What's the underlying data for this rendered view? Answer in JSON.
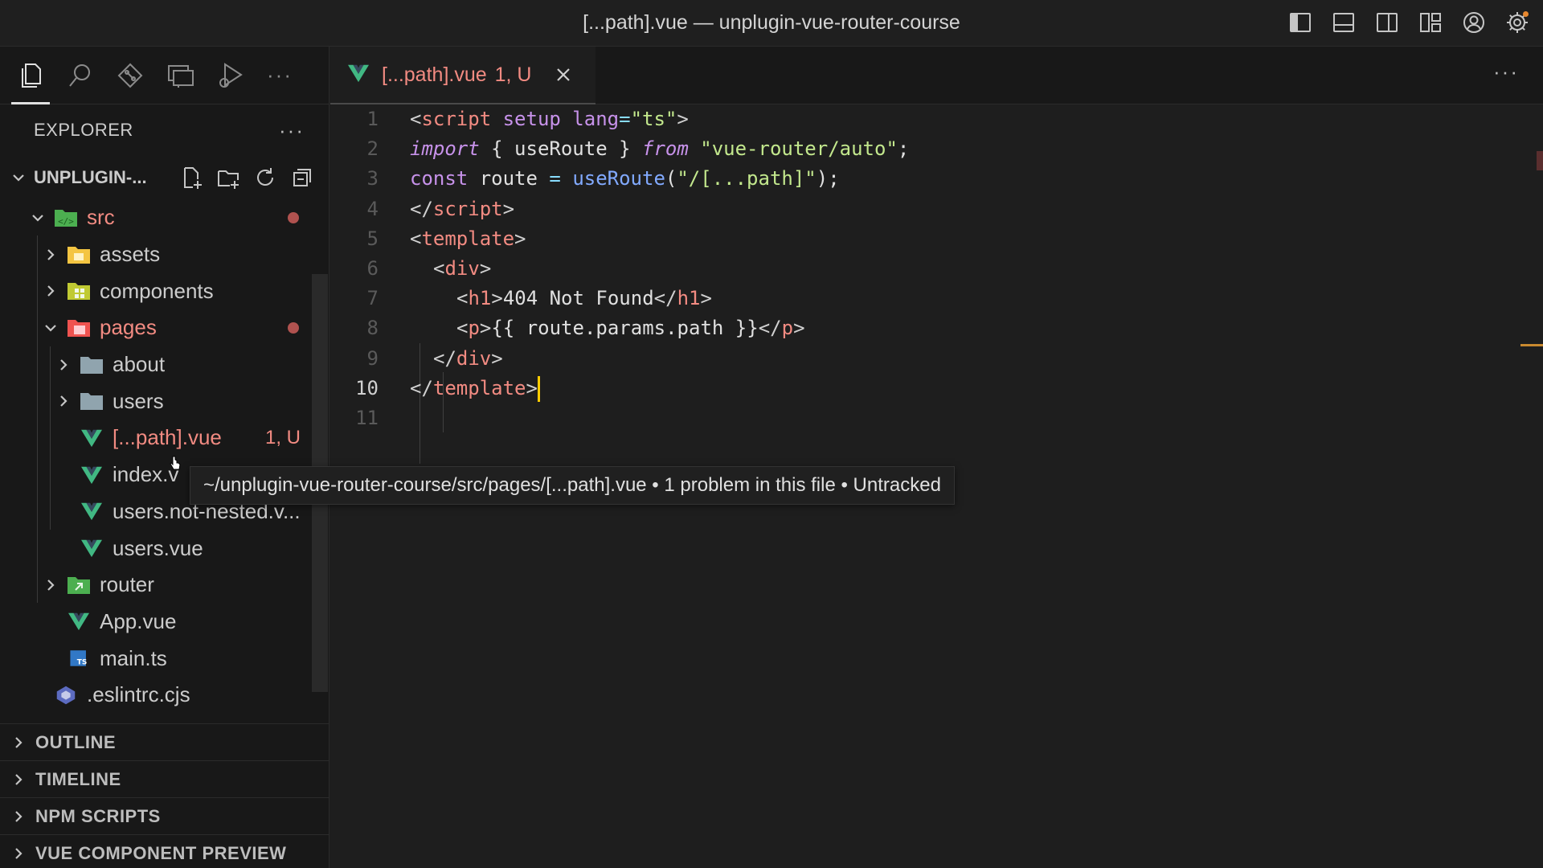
{
  "window": {
    "title": "[...path].vue — unplugin-vue-router-course"
  },
  "titlebar_icons": [
    "toggle-primary-sidebar-icon",
    "toggle-panel-icon",
    "toggle-secondary-sidebar-icon",
    "customize-layout-icon",
    "accounts-icon",
    "manage-gear-icon"
  ],
  "activity": {
    "more": "···"
  },
  "explorer": {
    "title": "EXPLORER",
    "more": "···",
    "project": "UNPLUGIN-..."
  },
  "tree": {
    "src": "src",
    "assets": "assets",
    "components": "components",
    "pages": "pages",
    "about": "about",
    "users": "users",
    "path_vue": "[...path].vue",
    "path_vue_badge": "1, U",
    "index_vue": "index.v",
    "users_not_nested": "users.not-nested.v...",
    "users_vue": "users.vue",
    "router": "router",
    "app_vue": "App.vue",
    "main_ts": "main.ts",
    "eslintrc": ".eslintrc.cjs"
  },
  "panels": {
    "outline": "OUTLINE",
    "timeline": "TIMELINE",
    "npm_scripts": "NPM SCRIPTS",
    "vue_preview": "VUE COMPONENT PREVIEW"
  },
  "tab": {
    "name": "[...path].vue",
    "badge": "1, U",
    "more": "···"
  },
  "code": {
    "line_numbers": [
      "1",
      "2",
      "3",
      "4",
      "5",
      "6",
      "7",
      "8",
      "9",
      "10",
      "11"
    ],
    "l1": {
      "lt": "<",
      "tag": "script",
      "attr1": " setup",
      "attr2": " lang",
      "eq": "=",
      "val": "\"ts\"",
      "gt": ">"
    },
    "l2": {
      "import": "import",
      "p1": " { useRoute } ",
      "from": "from",
      "sp": " ",
      "str": "\"vue-router/auto\"",
      "semi": ";"
    },
    "l3": {
      "const": "const",
      "name": " route ",
      "eq": "=",
      "sp": " ",
      "fn": "useRoute",
      "p1": "(",
      "str": "\"/[...path]\"",
      "p2": ");"
    },
    "l4": {
      "lt": "</",
      "tag": "script",
      "gt": ">"
    },
    "l5": {
      "lt": "<",
      "tag": "template",
      "gt": ">"
    },
    "l6": {
      "lt": "<",
      "tag": "div",
      "gt": ">"
    },
    "l7": {
      "lt": "<",
      "tag": "h1",
      "gt": ">",
      "text": "404 Not Found",
      "lt2": "</",
      "tag2": "h1",
      "gt2": ">"
    },
    "l8": {
      "lt": "<",
      "tag": "p",
      "gt": ">",
      "text": "{{ route.params.path }}",
      "lt2": "</",
      "tag2": "p",
      "gt2": ">"
    },
    "l9": {
      "lt": "</",
      "tag": "div",
      "gt": ">"
    },
    "l10": {
      "lt": "</",
      "tag": "template",
      "gt": ">"
    }
  },
  "tooltip": {
    "text": "~/unplugin-vue-router-course/src/pages/[...path].vue • 1 problem in this file • Untracked"
  },
  "colors": {
    "error_red": "#f28b82",
    "vue_green": "#41b883",
    "cursor_yellow": "#ffcc00",
    "ts_blue": "#3178c6"
  }
}
